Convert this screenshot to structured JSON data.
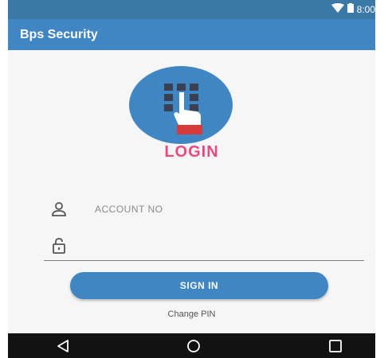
{
  "status_bar": {
    "time": "8:00"
  },
  "app_bar": {
    "title": "Bps Security"
  },
  "login": {
    "heading": "LOGIN",
    "account_placeholder": "ACCOUNT NO",
    "pin_placeholder": "",
    "sign_in_label": "SIGN IN",
    "change_pin_label": "Change PIN"
  },
  "nav_bar": {
    "back": "back-icon",
    "home": "home-icon",
    "recents": "recents-icon"
  },
  "colors": {
    "status_bar": "#3a78a8",
    "app_bar": "#3f86c3",
    "accent": "#3f86c3",
    "login_text": "#e84a7f",
    "background": "#f6f6f6"
  }
}
